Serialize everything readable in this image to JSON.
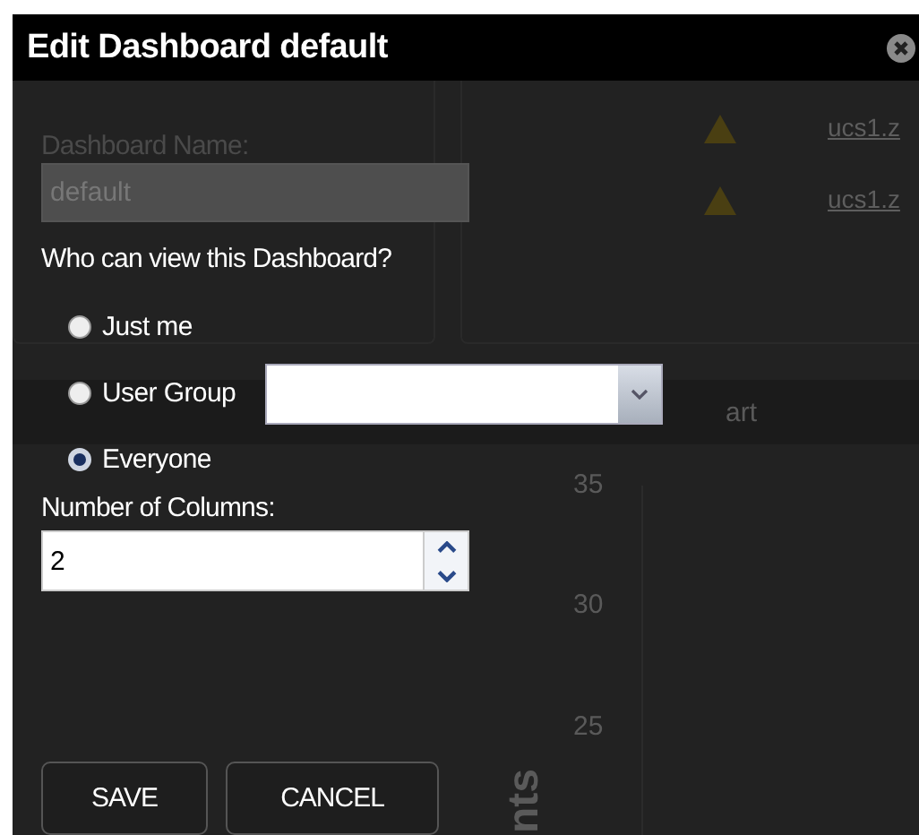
{
  "dialog": {
    "title": "Edit Dashboard default",
    "name_field": {
      "label": "Dashboard Name:",
      "value": "default",
      "disabled": true
    },
    "visibility": {
      "label": "Who can view this Dashboard?",
      "options": [
        {
          "label": "Just me",
          "selected": false
        },
        {
          "label": "User Group",
          "selected": false,
          "kind": "select"
        },
        {
          "label": "Everyone",
          "selected": true
        }
      ]
    },
    "columns_field": {
      "label": "Number of Columns:",
      "value": "2"
    },
    "buttons": [
      "SAVE",
      "CANCEL"
    ]
  },
  "background": {
    "links": [
      "ucs1.z",
      "ucs1.z"
    ],
    "chart_title": "art",
    "axis_ticks": [
      "35",
      "30",
      "25"
    ],
    "axis_label": "nts"
  }
}
